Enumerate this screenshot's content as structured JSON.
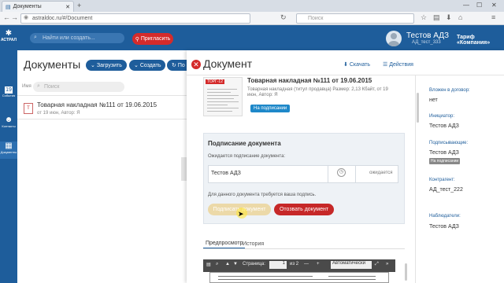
{
  "browser": {
    "tab_title": "Документы",
    "url": "astraldoc.ru/#/Document",
    "search_placeholder": "Поиск"
  },
  "header": {
    "logo_text": "АСТРАЛ",
    "search_placeholder": "Найти или создать...",
    "invite_label": "Пригласить",
    "user_name": "Тестов АДЗ",
    "user_org": "АД_тест_333",
    "tarif_label": "Тариф «Компания»"
  },
  "sidebar": {
    "items": [
      {
        "label": "События",
        "badge": "19"
      },
      {
        "label": "Контакты"
      },
      {
        "label": "Документы"
      }
    ]
  },
  "documents": {
    "title": "Документы",
    "buttons": {
      "upload": "Загрузить",
      "create": "Создать",
      "extra": "По"
    },
    "filter_label": "Имя",
    "filter_placeholder": "Поиск",
    "list": [
      {
        "title": "Товарная накладная №111 от 19.06.2015",
        "sub": "от 19 июн, Автор: Я"
      }
    ]
  },
  "panel": {
    "title": "Документ",
    "download": "Скачать",
    "actions": "Действия",
    "doc_name": "Товарная накладная №111 от 19.06.2015",
    "doc_meta_1": "Товарная накладная (титул продавца)   Размер: 2,13 Кбайт, от 19",
    "doc_meta_2": "июн, Автор: Я",
    "status_badge": "На подписании",
    "thumb_label": "ТОРГ-12",
    "sign": {
      "heading": "Подписание документа",
      "awaiting": "Ожидается подписание документа:",
      "signer": "Тестов АДЗ",
      "status": "ожидается",
      "note": "Для данного документа требуется ваша подпись.",
      "sign_button": "Подписать документ",
      "revoke_button": "Отозвать документ"
    },
    "tabs": {
      "preview": "Предпросмотр",
      "history": "История"
    },
    "pdf": {
      "page_label": "Страница:",
      "page_num": "1",
      "page_of": "из 2",
      "zoom": "Автоматически"
    }
  },
  "info": {
    "in_contract_label": "Вложен в договор:",
    "in_contract_val": "нет",
    "initiator_label": "Инициатор:",
    "initiator_val": "Тестов АДЗ",
    "signers_label": "Подписывающие:",
    "signers_val": "Тестов АДЗ",
    "signers_badge": "На подписании",
    "counterparty_label": "Контрагент:",
    "counterparty_val": "АД_тест_222",
    "observers_label": "Наблюдатели:",
    "observers_val": "Тестов АДЗ"
  }
}
